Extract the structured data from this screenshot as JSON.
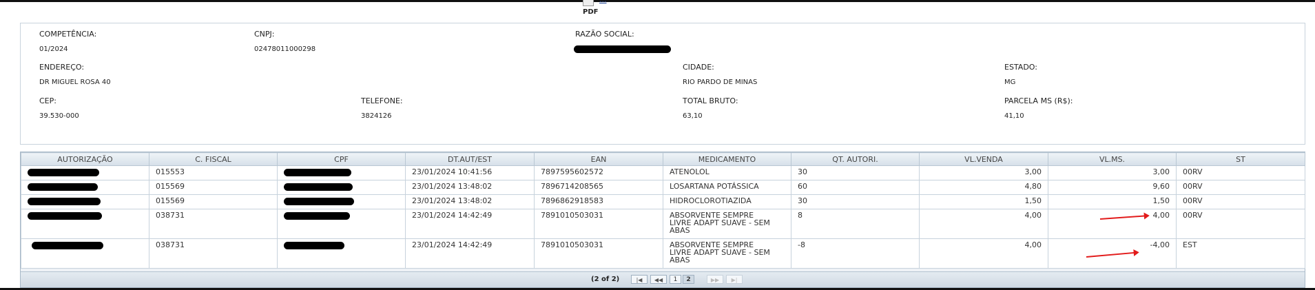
{
  "export": {
    "pdf_label": "PDF",
    "link_text": "..."
  },
  "info": {
    "competencia": {
      "label": "COMPETÊNCIA:",
      "value": "01/2024"
    },
    "cnpj": {
      "label": "CNPJ:",
      "value": "02478011000298"
    },
    "razao_social": {
      "label": "RAZÃO SOCIAL:"
    },
    "endereco": {
      "label": "ENDEREÇO:",
      "value": "DR MIGUEL ROSA 40"
    },
    "cidade": {
      "label": "CIDADE:",
      "value": "RIO PARDO DE MINAS"
    },
    "estado": {
      "label": "ESTADO:",
      "value": "MG"
    },
    "cep": {
      "label": "CEP:",
      "value": "39.530-000"
    },
    "telefone": {
      "label": "TELEFONE:",
      "value": "3824126"
    },
    "total_bruto": {
      "label": "TOTAL BRUTO:",
      "value": "63,10"
    },
    "parcela_ms": {
      "label": "PARCELA MS (R$):",
      "value": "41,10"
    }
  },
  "table": {
    "headers": [
      "AUTORIZAÇÃO",
      "C. FISCAL",
      "CPF",
      "DT.AUT/EST",
      "EAN",
      "MEDICAMENTO",
      "QT. AUTORI.",
      "VL.VENDA",
      "VL.MS.",
      "ST"
    ],
    "rows": [
      {
        "c_fiscal": "015553",
        "dt": "23/01/2024 10:41:56",
        "ean": "7897595602572",
        "medicamento": "ATENOLOL",
        "qt": "30",
        "vl_venda": "3,00",
        "vl_ms": "3,00",
        "st": "00RV"
      },
      {
        "c_fiscal": "015569",
        "dt": "23/01/2024 13:48:02",
        "ean": "7896714208565",
        "medicamento": "LOSARTANA POTÁSSICA",
        "qt": "60",
        "vl_venda": "4,80",
        "vl_ms": "9,60",
        "st": "00RV"
      },
      {
        "c_fiscal": "015569",
        "dt": "23/01/2024 13:48:02",
        "ean": "7896862918583",
        "medicamento": "HIDROCLOROTIAZIDA",
        "qt": "30",
        "vl_venda": "1,50",
        "vl_ms": "1,50",
        "st": "00RV"
      },
      {
        "c_fiscal": "038731",
        "dt": "23/01/2024 14:42:49",
        "ean": "7891010503031",
        "medicamento_lines": [
          "ABSORVENTE SEMPRE",
          "LIVRE ADAPT SUAVE - SEM",
          "ABAS"
        ],
        "qt": "8",
        "vl_venda": "4,00",
        "vl_ms": "4,00",
        "st": "00RV"
      },
      {
        "c_fiscal": "038731",
        "dt": "23/01/2024 14:42:49",
        "ean": "7891010503031",
        "medicamento_lines": [
          "ABSORVENTE SEMPRE",
          "LIVRE ADAPT SUAVE - SEM",
          "ABAS"
        ],
        "qt": "-8",
        "vl_venda": "4,00",
        "vl_ms": "-4,00",
        "st": "EST"
      }
    ]
  },
  "pager": {
    "status": "(2 of 2)",
    "first": "|◀",
    "prev": "◀◀",
    "next": "▶▶",
    "last": "▶|",
    "pages": [
      "1",
      "2"
    ]
  },
  "annotations": {
    "arrow_color": "#e21b1b"
  }
}
